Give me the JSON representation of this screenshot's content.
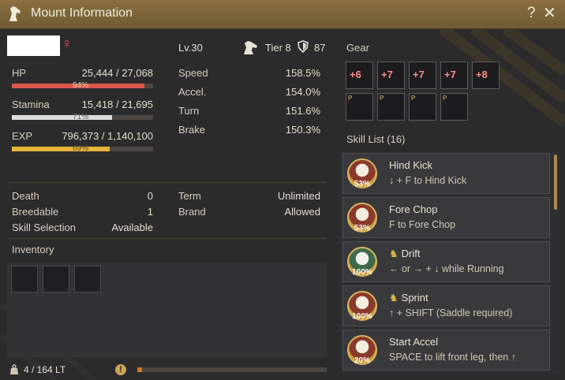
{
  "window": {
    "title": "Mount Information",
    "help": "?",
    "close": "✕"
  },
  "header": {
    "gender_symbol": "♀",
    "level": "Lv.30",
    "tier": "Tier 8",
    "armor_value": "87"
  },
  "stats": {
    "hp": {
      "label": "HP",
      "value": "25,444 / 27,068",
      "percent_text": "94%",
      "fraction": 0.94,
      "color": "#d9574b"
    },
    "stamina": {
      "label": "Stamina",
      "value": "15,418 / 21,695",
      "percent_text": "71%",
      "fraction": 0.71,
      "color": "#dcdcdc"
    },
    "exp": {
      "label": "EXP",
      "value": "796,373 / 1,140,100",
      "percent_text": "69%",
      "fraction": 0.69,
      "color": "#e8b43a"
    }
  },
  "attributes": [
    {
      "label": "Speed",
      "value": "158.5%"
    },
    {
      "label": "Accel.",
      "value": "154.0%"
    },
    {
      "label": "Turn",
      "value": "151.6%"
    },
    {
      "label": "Brake",
      "value": "150.3%"
    }
  ],
  "info": {
    "death": {
      "label": "Death",
      "value": "0"
    },
    "breedable": {
      "label": "Breedable",
      "value": "1"
    },
    "skill_selection": {
      "label": "Skill Selection",
      "value": "Available"
    },
    "term": {
      "label": "Term",
      "value": "Unlimited"
    },
    "brand": {
      "label": "Brand",
      "value": "Allowed"
    }
  },
  "inventory": {
    "label": "Inventory",
    "weight": "4 / 164 LT",
    "weight_fraction": 0.025
  },
  "gear": {
    "label": "Gear",
    "row1": [
      "+6",
      "+7",
      "+7",
      "+7",
      "+8"
    ],
    "row2": [
      "P",
      "P",
      "P",
      "P"
    ]
  },
  "skills": {
    "label": "Skill List (16)",
    "items": [
      {
        "name": "Hind Kick",
        "desc": "↓ + F to Hind Kick",
        "pct": "53%",
        "horse": false,
        "icon": "hind-kick-skill-icon"
      },
      {
        "name": "Fore Chop",
        "desc": "F to Fore Chop",
        "pct": "53%",
        "horse": false,
        "icon": "fore-chop-skill-icon"
      },
      {
        "name": "Drift",
        "desc": "← or → + ↓ while Running",
        "pct": "100%",
        "horse": true,
        "icon": "drift-skill-icon"
      },
      {
        "name": "Sprint",
        "desc": "↑ + SHIFT (Saddle required)",
        "pct": "100%",
        "horse": true,
        "icon": "sprint-skill-icon"
      },
      {
        "name": "Start Accel",
        "desc": "SPACE to lift front leg, then ↑",
        "pct": "20%",
        "horse": false,
        "icon": "start-accel-skill-icon"
      }
    ]
  }
}
